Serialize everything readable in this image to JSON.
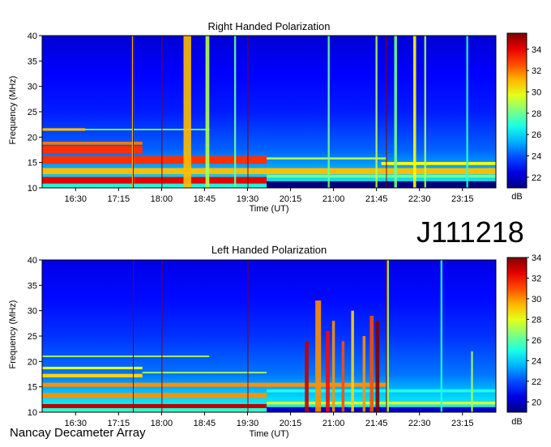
{
  "header": {
    "id_label": "J111218"
  },
  "footer": {
    "label": "Nancay Decameter Array"
  },
  "chart_data": [
    {
      "type": "heatmap",
      "title": "Right Handed Polarization",
      "xlabel": "Time (UT)",
      "ylabel": "Frequency (MHz)",
      "xticks": [
        "16:30",
        "17:15",
        "18:00",
        "18:45",
        "19:30",
        "20:15",
        "21:00",
        "21:45",
        "22:30",
        "23:15"
      ],
      "xrange_minutes": [
        955,
        1430
      ],
      "yticks": [
        10,
        15,
        20,
        25,
        30,
        35,
        40
      ],
      "ylim": [
        10,
        40
      ],
      "colorbar": {
        "label": "dB",
        "ticks": [
          22,
          24,
          26,
          28,
          30,
          32,
          34
        ],
        "range": [
          21,
          35.5
        ]
      },
      "bands": [
        {
          "f": 11.5,
          "w": 1.3,
          "x0": 955,
          "x1": 1190,
          "db": 34
        },
        {
          "f": 13.3,
          "w": 1.2,
          "x0": 955,
          "x1": 1430,
          "db": 31
        },
        {
          "f": 15.5,
          "w": 1.5,
          "x0": 955,
          "x1": 1190,
          "db": 33
        },
        {
          "f": 17.5,
          "w": 1.5,
          "x0": 955,
          "x1": 1060,
          "db": 33
        },
        {
          "f": 18.8,
          "w": 0.6,
          "x0": 955,
          "x1": 1060,
          "db": 32
        },
        {
          "f": 21.5,
          "w": 0.5,
          "x0": 955,
          "x1": 1000,
          "db": 31
        },
        {
          "f": 21.5,
          "w": 0.3,
          "x0": 1000,
          "x1": 1130,
          "db": 28
        },
        {
          "f": 15.8,
          "w": 0.4,
          "x0": 1190,
          "x1": 1315,
          "db": 29
        },
        {
          "f": 14.8,
          "w": 0.6,
          "x0": 1310,
          "x1": 1430,
          "db": 30
        },
        {
          "f": 12.3,
          "w": 0.6,
          "x0": 1190,
          "x1": 1430,
          "db": 28
        }
      ],
      "bursts": [
        {
          "t": 1050,
          "w": 2,
          "f0": 10,
          "f1": 40,
          "db": 31
        },
        {
          "t": 1107,
          "w": 8,
          "f0": 10,
          "f1": 40,
          "db": 31
        },
        {
          "t": 1128,
          "w": 4,
          "f0": 10,
          "f1": 40,
          "db": 29
        },
        {
          "t": 1157,
          "w": 2,
          "f0": 10,
          "f1": 40,
          "db": 28
        },
        {
          "t": 1255,
          "w": 2,
          "f0": 10,
          "f1": 40,
          "db": 28
        },
        {
          "t": 1305,
          "w": 2,
          "f0": 10,
          "f1": 40,
          "db": 29
        },
        {
          "t": 1325,
          "w": 3,
          "f0": 10,
          "f1": 40,
          "db": 28
        },
        {
          "t": 1345,
          "w": 3,
          "f0": 10,
          "f1": 40,
          "db": 30
        },
        {
          "t": 1356,
          "w": 2,
          "f0": 10,
          "f1": 40,
          "db": 29
        },
        {
          "t": 1400,
          "w": 2,
          "f0": 10,
          "f1": 40,
          "db": 27
        }
      ],
      "dark_lines": [
        1050,
        1080,
        1170,
        1315
      ],
      "bottom_band": {
        "f0": 10,
        "f1": 11.3,
        "x0": 1190,
        "x1": 1430,
        "db": 21
      }
    },
    {
      "type": "heatmap",
      "title": "Left Handed Polarization",
      "xlabel": "Time (UT)",
      "ylabel": "Frequency (MHz)",
      "xticks": [
        "16:30",
        "17:15",
        "18:00",
        "18:45",
        "19:30",
        "20:15",
        "21:00",
        "21:45",
        "22:30",
        "23:15"
      ],
      "xrange_minutes": [
        955,
        1430
      ],
      "yticks": [
        10,
        15,
        20,
        25,
        30,
        35,
        40
      ],
      "ylim": [
        10,
        40
      ],
      "colorbar": {
        "label": "dB",
        "ticks": [
          20,
          22,
          24,
          26,
          28,
          30,
          32,
          34
        ],
        "range": [
          19,
          34
        ]
      },
      "bands": [
        {
          "f": 11.2,
          "w": 0.8,
          "x0": 955,
          "x1": 1190,
          "db": 33
        },
        {
          "f": 11.8,
          "w": 0.5,
          "x0": 1190,
          "x1": 1430,
          "db": 28
        },
        {
          "f": 13.3,
          "w": 1.0,
          "x0": 955,
          "x1": 1190,
          "db": 30
        },
        {
          "f": 15.4,
          "w": 0.8,
          "x0": 955,
          "x1": 1315,
          "db": 30
        },
        {
          "f": 17.2,
          "w": 0.7,
          "x0": 955,
          "x1": 1060,
          "db": 29
        },
        {
          "f": 18.7,
          "w": 0.5,
          "x0": 955,
          "x1": 1060,
          "db": 28
        },
        {
          "f": 17.8,
          "w": 0.3,
          "x0": 1060,
          "x1": 1190,
          "db": 27
        },
        {
          "f": 21.0,
          "w": 0.3,
          "x0": 955,
          "x1": 1130,
          "db": 27
        },
        {
          "f": 14.2,
          "w": 0.6,
          "x0": 1190,
          "x1": 1430,
          "db": 25
        }
      ],
      "bursts": [
        {
          "t": 1232,
          "w": 4,
          "f0": 10,
          "f1": 24,
          "db": 33
        },
        {
          "t": 1244,
          "w": 6,
          "f0": 10,
          "f1": 32,
          "db": 30
        },
        {
          "t": 1254,
          "w": 4,
          "f0": 10,
          "f1": 26,
          "db": 32
        },
        {
          "t": 1260,
          "w": 3,
          "f0": 10,
          "f1": 28,
          "db": 30
        },
        {
          "t": 1270,
          "w": 3,
          "f0": 10,
          "f1": 24,
          "db": 31
        },
        {
          "t": 1280,
          "w": 3,
          "f0": 10,
          "f1": 30,
          "db": 29
        },
        {
          "t": 1292,
          "w": 3,
          "f0": 10,
          "f1": 25,
          "db": 30
        },
        {
          "t": 1300,
          "w": 4,
          "f0": 10,
          "f1": 29,
          "db": 31
        },
        {
          "t": 1306,
          "w": 4,
          "f0": 10,
          "f1": 28,
          "db": 35
        },
        {
          "t": 1317,
          "w": 2,
          "f0": 10,
          "f1": 40,
          "db": 27
        },
        {
          "t": 1373,
          "w": 2,
          "f0": 10,
          "f1": 40,
          "db": 25
        },
        {
          "t": 1405,
          "w": 2,
          "f0": 10,
          "f1": 22,
          "db": 27
        }
      ],
      "dark_lines": [
        1050,
        1080,
        1170,
        1315
      ],
      "bottom_band": {
        "f0": 10,
        "f1": 11.0,
        "x0": 1190,
        "x1": 1430,
        "db": 20
      }
    }
  ]
}
